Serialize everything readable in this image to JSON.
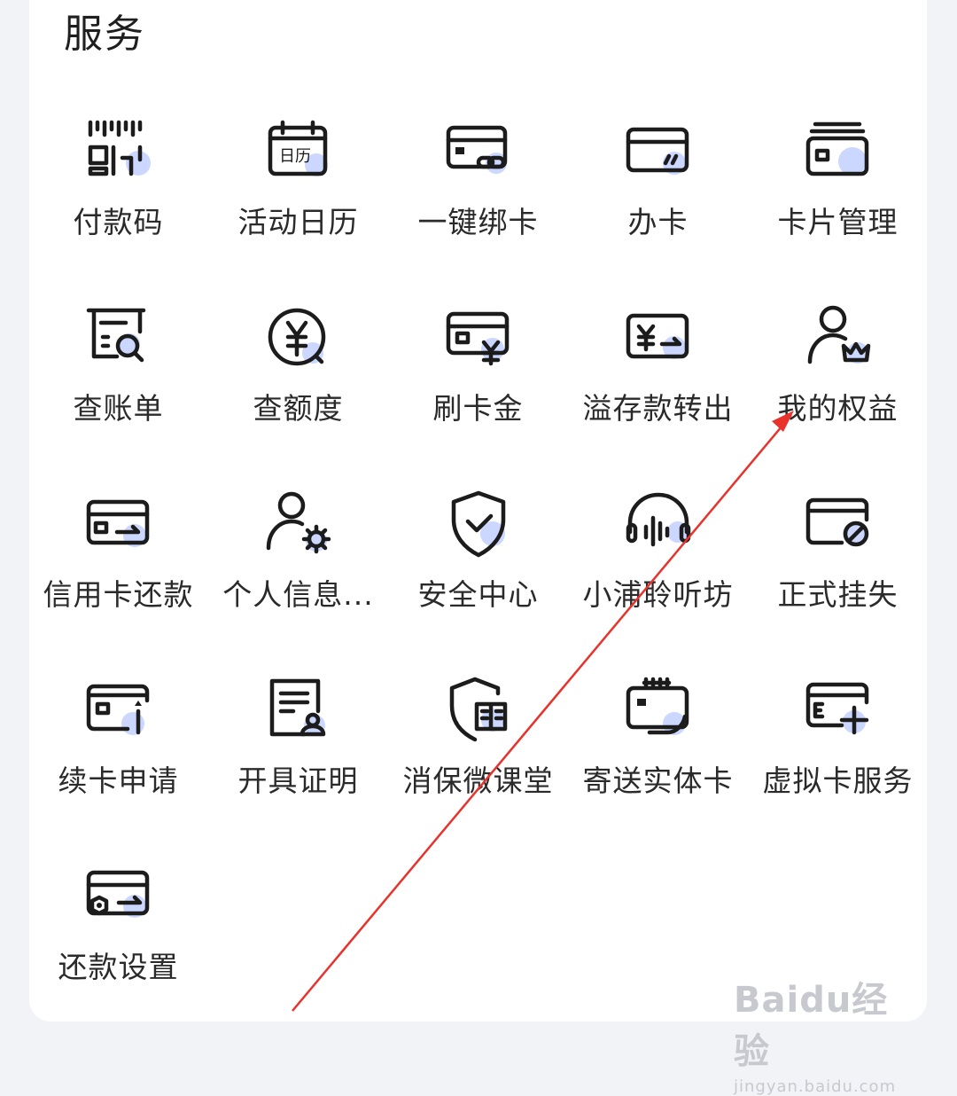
{
  "section": {
    "title": "服务"
  },
  "items": [
    {
      "label": "付款码",
      "icon": "barcode-pay-icon"
    },
    {
      "label": "活动日历",
      "icon": "calendar-icon"
    },
    {
      "label": "一键绑卡",
      "icon": "bind-card-icon"
    },
    {
      "label": "办卡",
      "icon": "apply-card-icon"
    },
    {
      "label": "卡片管理",
      "icon": "card-manage-icon"
    },
    {
      "label": "查账单",
      "icon": "bill-search-icon"
    },
    {
      "label": "查额度",
      "icon": "credit-limit-icon"
    },
    {
      "label": "刷卡金",
      "icon": "card-cashback-icon"
    },
    {
      "label": "溢存款转出",
      "icon": "overpayment-transfer-icon"
    },
    {
      "label": "我的权益",
      "icon": "member-benefits-icon"
    },
    {
      "label": "信用卡还款",
      "icon": "card-repay-icon"
    },
    {
      "label": "个人信息...",
      "icon": "personal-info-icon"
    },
    {
      "label": "安全中心",
      "icon": "shield-check-icon"
    },
    {
      "label": "小浦聆听坊",
      "icon": "headphones-icon"
    },
    {
      "label": "正式挂失",
      "icon": "report-loss-icon"
    },
    {
      "label": "续卡申请",
      "icon": "renew-card-icon"
    },
    {
      "label": "开具证明",
      "icon": "certificate-icon"
    },
    {
      "label": "消保微课堂",
      "icon": "consumer-class-icon"
    },
    {
      "label": "寄送实体卡",
      "icon": "mail-card-icon"
    },
    {
      "label": "虚拟卡服务",
      "icon": "virtual-card-icon"
    },
    {
      "label": "还款设置",
      "icon": "repay-settings-icon"
    }
  ],
  "annotation": {
    "arrow_color": "#e8322b"
  },
  "watermark": {
    "logo": "Baidu经验",
    "url": "jingyan.baidu.com"
  }
}
